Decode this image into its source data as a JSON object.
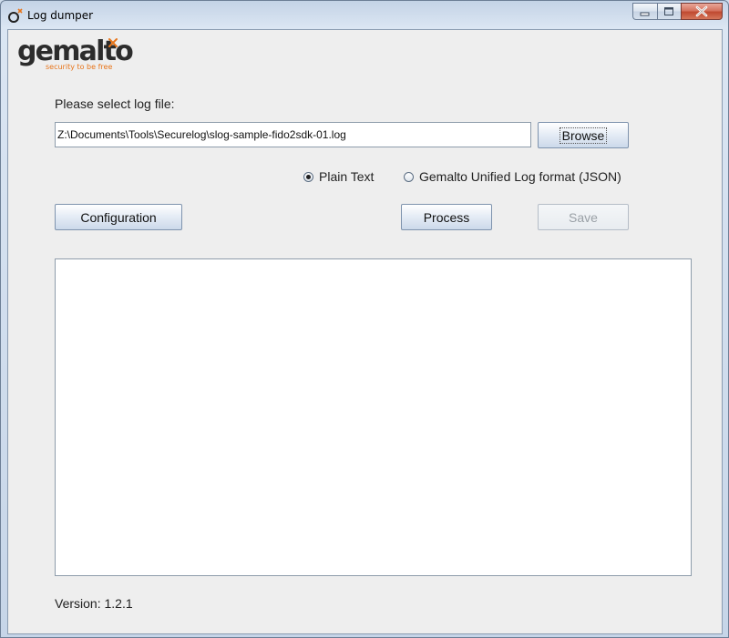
{
  "window": {
    "title": "Log dumper",
    "minimize_icon": "minimize-icon",
    "maximize_icon": "maximize-icon",
    "close_icon": "close-icon"
  },
  "logo": {
    "word": "gemalto",
    "tagline": "security to be free",
    "accent_color": "#e8751a"
  },
  "form": {
    "select_label": "Please select log file:",
    "file_path": "Z:\\Documents\\Tools\\Securelog\\slog-sample-fido2sdk-01.log",
    "browse_label": "Browse",
    "format_options": [
      {
        "label": "Plain Text",
        "checked": true
      },
      {
        "label": "Gemalto Unified Log format (JSON)",
        "checked": false
      }
    ],
    "configuration_label": "Configuration",
    "process_label": "Process",
    "save_label": "Save",
    "save_enabled": false,
    "output_text": ""
  },
  "footer": {
    "version": "Version: 1.2.1"
  }
}
